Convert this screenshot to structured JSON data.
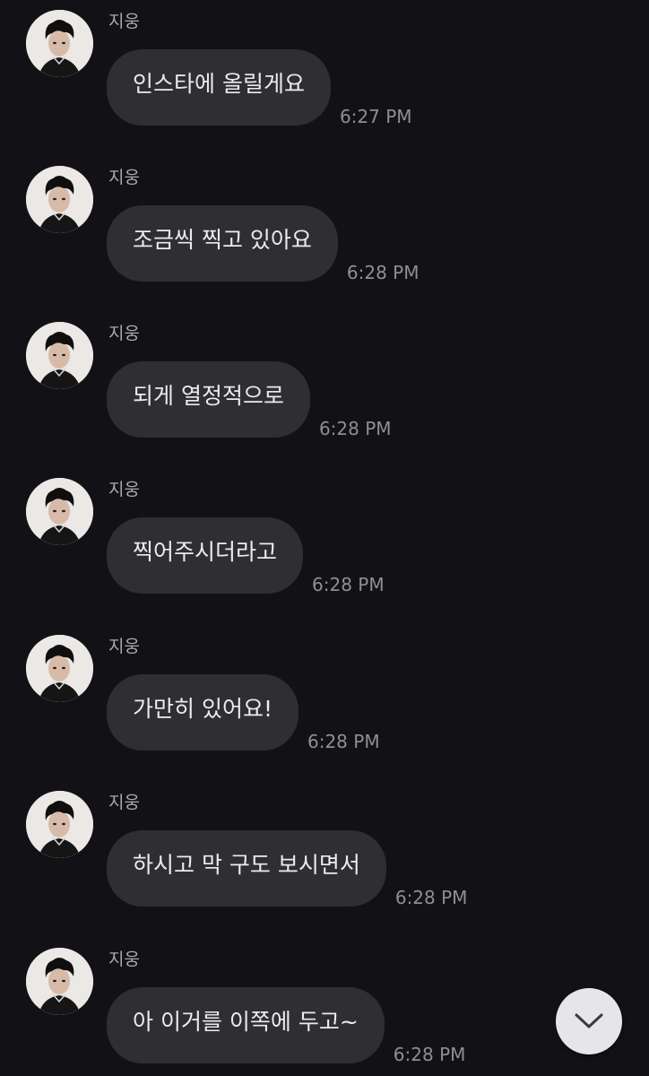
{
  "messages": [
    {
      "sender": "지웅",
      "text": "인스타에 올릴게요",
      "time": "6:27 PM"
    },
    {
      "sender": "지웅",
      "text": "조금씩 찍고 있아요",
      "time": "6:28 PM"
    },
    {
      "sender": "지웅",
      "text": "되게 열정적으로",
      "time": "6:28 PM"
    },
    {
      "sender": "지웅",
      "text": "찍어주시더라고",
      "time": "6:28 PM"
    },
    {
      "sender": "지웅",
      "text": "가만히 있어요!",
      "time": "6:28 PM"
    },
    {
      "sender": "지웅",
      "text": "하시고 막 구도 보시면서",
      "time": "6:28 PM"
    },
    {
      "sender": "지웅",
      "text": "아 이거를 이쪽에 두고~",
      "time": "6:28 PM"
    }
  ],
  "scroll_button": {
    "icon": "chevron-down-icon"
  },
  "colors": {
    "background": "#121216",
    "bubble": "#2e2e33",
    "bubble_text": "#ececee",
    "meta_text": "#8e8e94",
    "scroll_button": "#e6e6e8"
  }
}
